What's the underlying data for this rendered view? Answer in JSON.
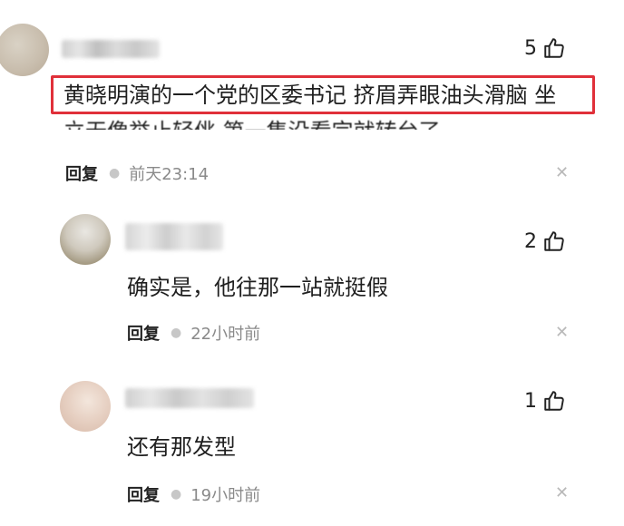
{
  "comments": [
    {
      "likes": "5",
      "text": "黄晓明演的一个党的区委书记 挤眉弄眼油头滑脑 坐",
      "text_cont": "立无像举止轻佻 第一集没看完就转台了",
      "reply_label": "回复",
      "time": "前天23:14"
    },
    {
      "likes": "2",
      "text": "确实是，他往那一站就挺假",
      "reply_label": "回复",
      "time": "22小时前"
    },
    {
      "likes": "1",
      "text": "还有那发型",
      "reply_label": "回复",
      "time": "19小时前"
    }
  ],
  "icons": {
    "like": "thumbs-up-icon",
    "close": "close-icon"
  },
  "colors": {
    "highlight": "#e0303a",
    "meta_time": "#8a8a8a"
  }
}
